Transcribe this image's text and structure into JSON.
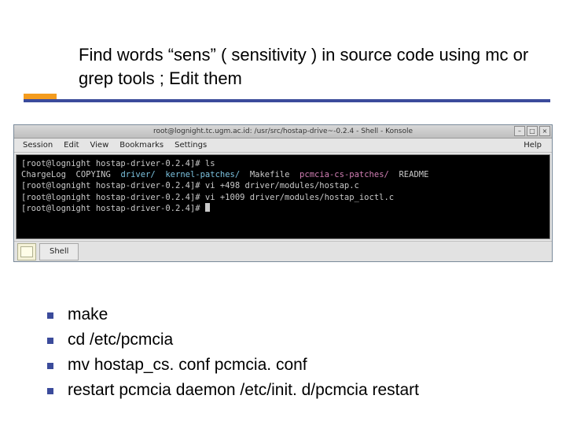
{
  "title": "Find words “sens” ( sensitivity ) in source code using mc or grep tools ; Edit them",
  "terminal": {
    "windowTitle": "root@lognight.tc.ugm.ac.id: /usr/src/hostap-drive~-0.2.4 - Shell - Konsole",
    "menus": [
      "Session",
      "Edit",
      "View",
      "Bookmarks",
      "Settings",
      "Help"
    ],
    "lines": {
      "l1a": "[root@lognight hostap-driver-0.2.4]# ls",
      "l2a": "ChargeLog  COPYING  ",
      "l2b": "driver/",
      "l2c": "  ",
      "l2d": "kernel-patches/",
      "l2e": "  Makefile  ",
      "l2f": "pcmcia-cs-patches/",
      "l2g": "  README",
      "l3a": "[root@lognight hostap-driver-0.2.4]# vi +498 driver/modules/hostap.c",
      "l4a": "[root@lognight hostap-driver-0.2.4]# vi +1009 driver/modules/hostap_ioctl.c",
      "l5a": "[root@lognight hostap-driver-0.2.4]# "
    },
    "tabLabel": "Shell"
  },
  "bullets": [
    "make",
    "cd /etc/pcmcia",
    "mv hostap_cs. conf pcmcia. conf",
    "restart pcmcia daemon /etc/init. d/pcmcia restart"
  ]
}
